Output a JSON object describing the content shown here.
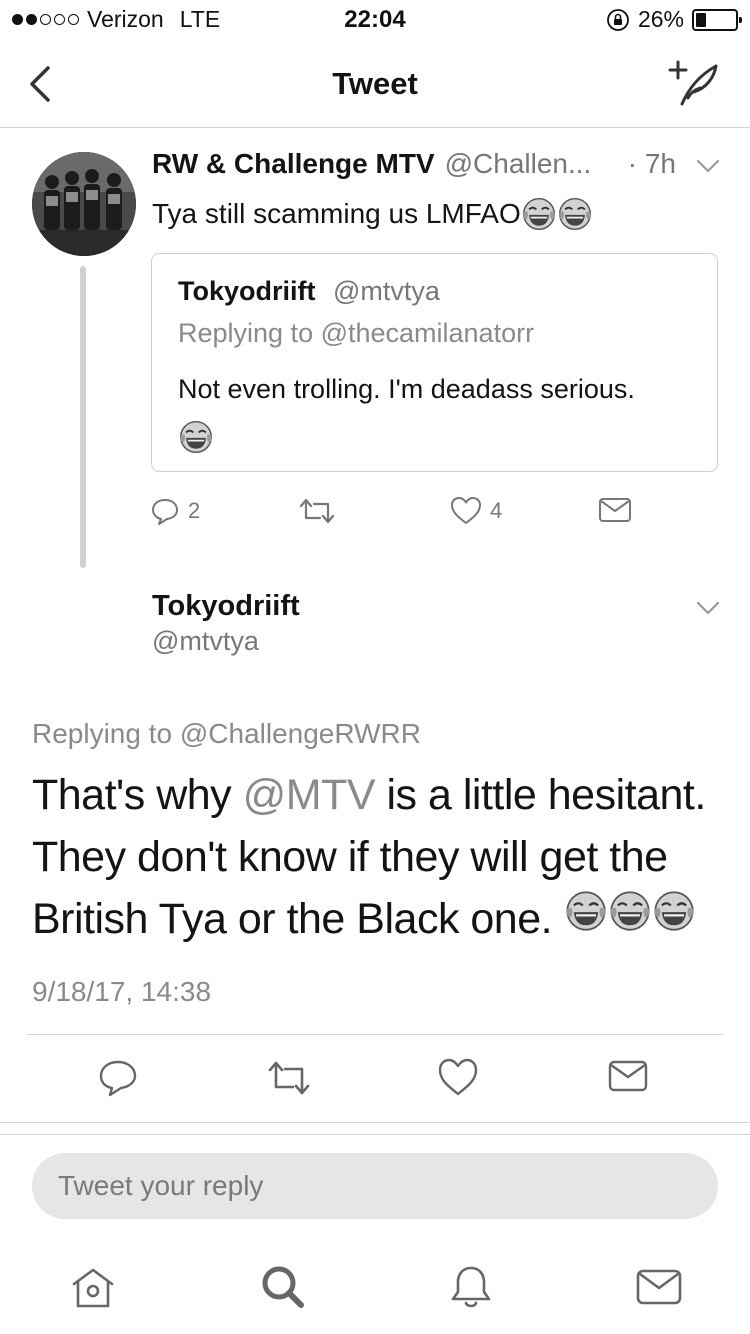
{
  "status_bar": {
    "carrier": "Verizon",
    "network": "LTE",
    "time": "22:04",
    "battery_percent": "26%",
    "battery_level": 0.26,
    "signal_bars_filled": 2,
    "signal_bars_total": 5
  },
  "nav": {
    "title": "Tweet",
    "back_icon": "chevron-left-icon",
    "compose_icon": "compose-tweet-icon"
  },
  "parent_tweet": {
    "author_name": "RW & Challenge MTV",
    "author_handle": "@Challen...",
    "time_ago": "· 7h",
    "text": "Tya still scamming us LMFAO",
    "emoji_count": 2,
    "quoted": {
      "author_name": "Tokyodriift",
      "author_handle": "@mtvtya",
      "replying_to": "Replying to @thecamilanatorr",
      "text": "Not even trolling. I'm deadass serious."
    },
    "actions": {
      "replies": "2",
      "retweets": "",
      "likes": "4"
    }
  },
  "main_tweet": {
    "author_name": "Tokyodriift",
    "author_handle": "@mtvtya",
    "replying_to": "Replying to @ChallengeRWRR",
    "text_before_mention": "That's why ",
    "mention": "@MTV",
    "text_after_mention": " is a little hesitant. They don't know if they will get the British Tya or the Black one.",
    "emoji_count": 3,
    "date": "9/18/17, 14:38"
  },
  "reply_bar": {
    "placeholder": "Tweet your reply"
  },
  "tabbar": {
    "items": [
      "home-icon",
      "search-icon",
      "notifications-icon",
      "messages-icon"
    ]
  },
  "colors": {
    "text_primary": "#141414",
    "text_secondary": "#777777",
    "divider": "#d4d4d4",
    "input_bg": "#e6e6e6"
  }
}
